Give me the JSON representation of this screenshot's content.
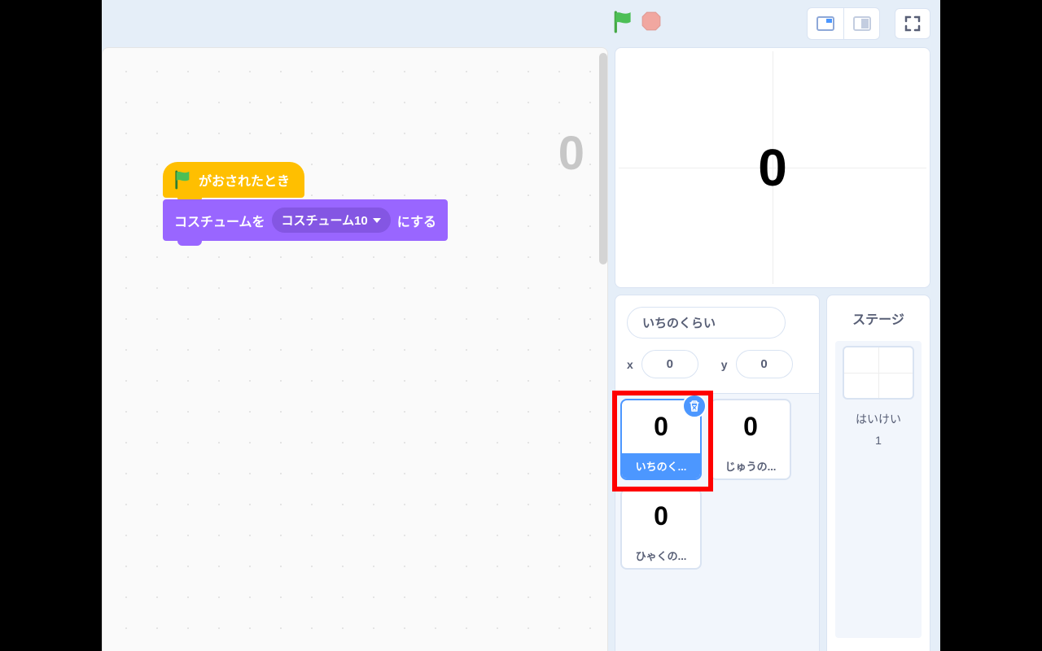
{
  "topbar": {
    "green_flag": "green-flag",
    "stop": "stop"
  },
  "code": {
    "preview_number": "0",
    "hat_block_label": "がおされたとき",
    "looks_block_prefix": "コスチュームを",
    "looks_block_dropdown": "コスチューム10",
    "looks_block_suffix": "にする"
  },
  "stage": {
    "display_value": "0"
  },
  "sprite_info": {
    "name": "いちのくらい",
    "x_label": "x",
    "x_value": "0",
    "y_label": "y",
    "y_value": "0"
  },
  "sprites": [
    {
      "thumb": "0",
      "label": "いちのく...",
      "selected": true
    },
    {
      "thumb": "0",
      "label": "じゅうの...",
      "selected": false
    },
    {
      "thumb": "0",
      "label": "ひゃくの...",
      "selected": false
    }
  ],
  "stage_panel": {
    "title": "ステージ",
    "backdrop_label": "はいけい",
    "backdrop_count": "1"
  }
}
